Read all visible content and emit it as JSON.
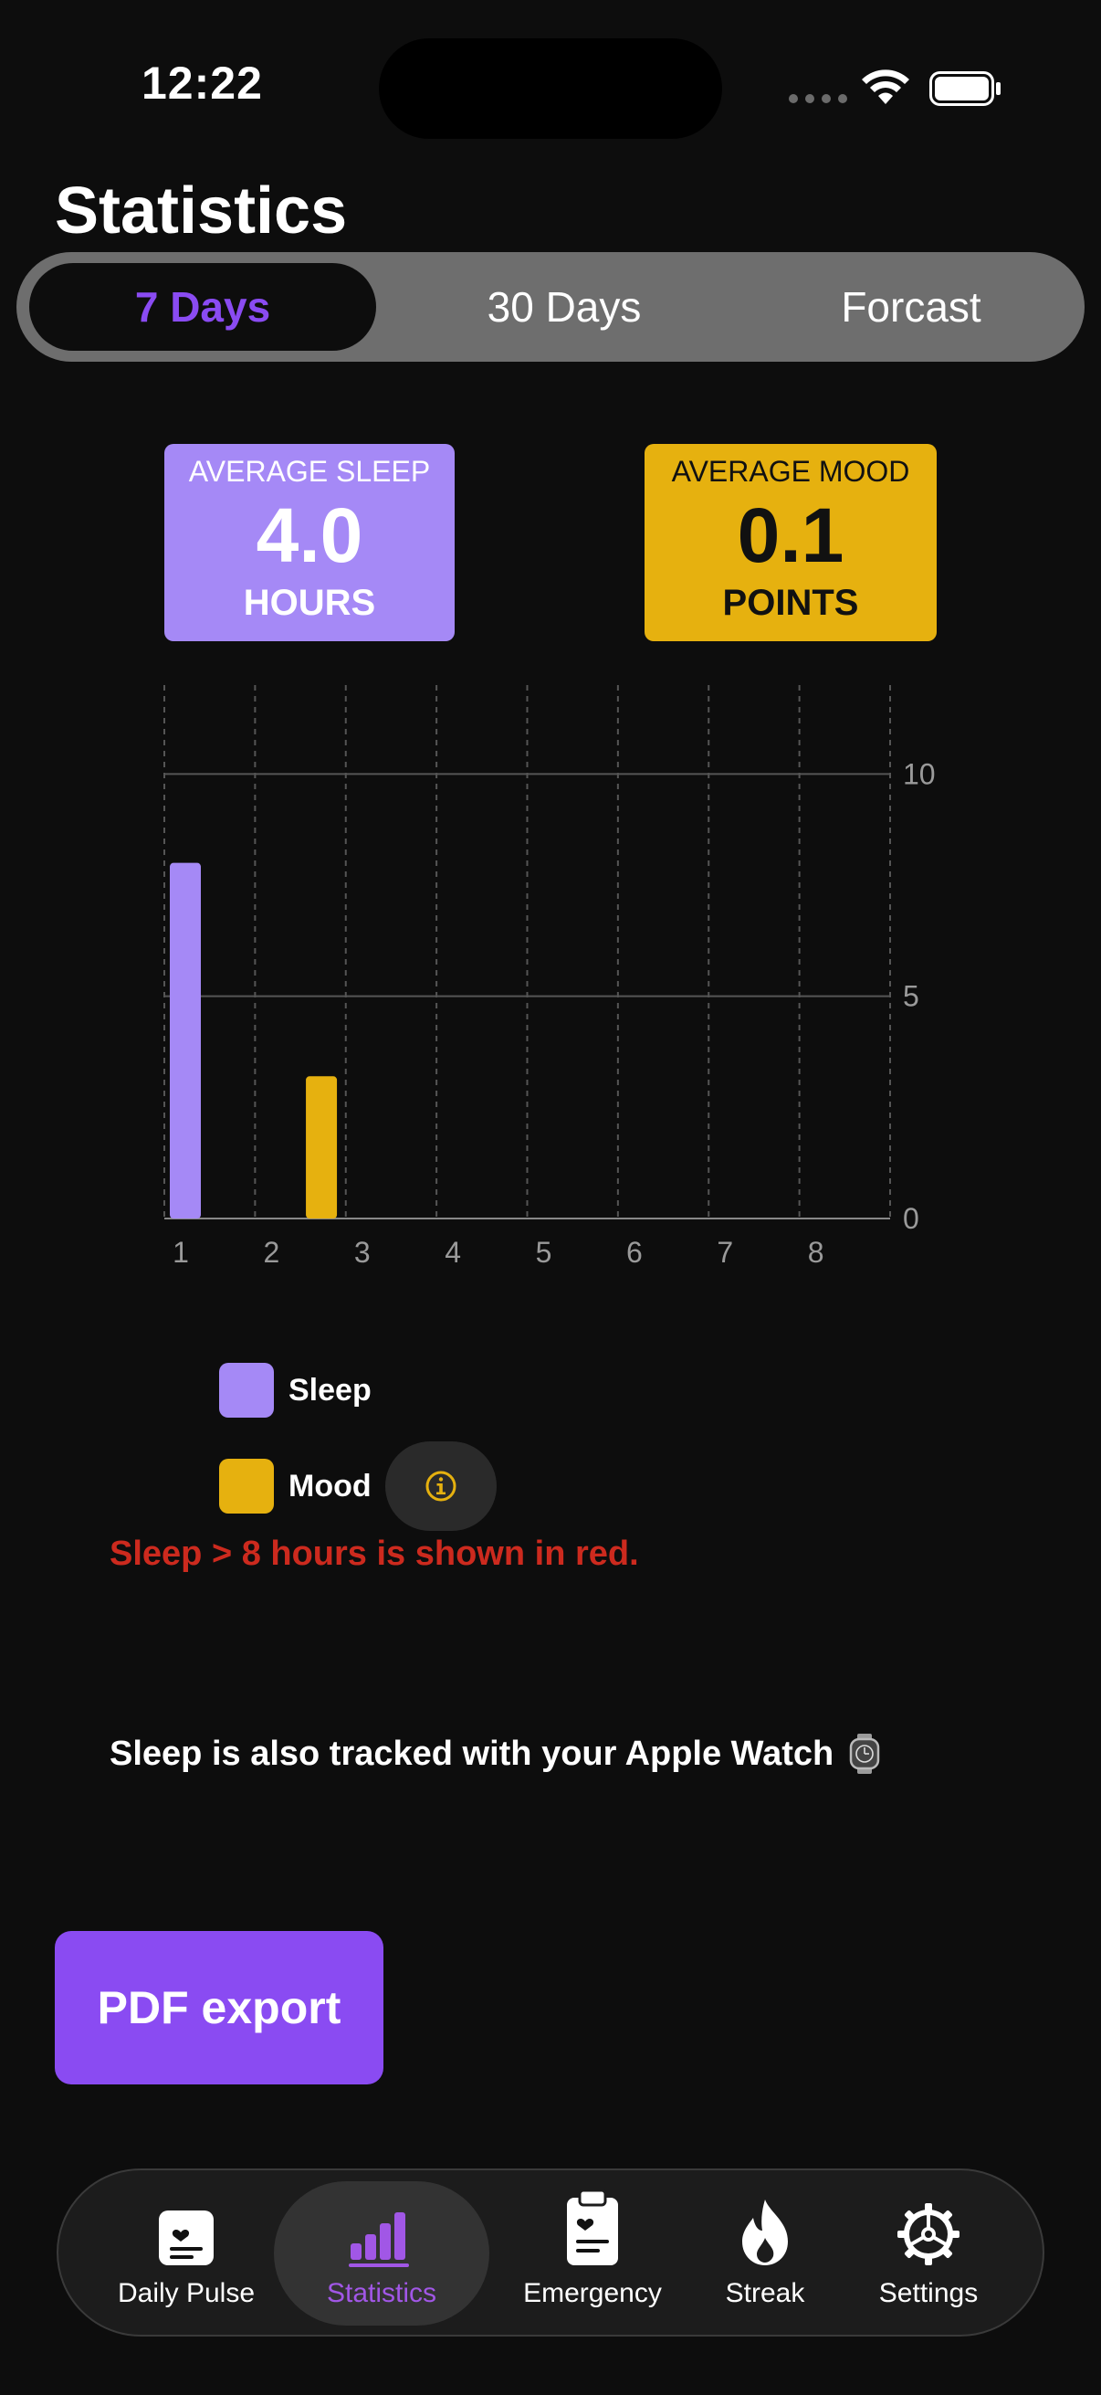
{
  "status_bar": {
    "time": "12:22",
    "icons": [
      "signal-dots-icon",
      "wifi-icon",
      "battery-icon"
    ]
  },
  "page": {
    "title": "Statistics"
  },
  "range_tabs": {
    "items": [
      {
        "label": "7 Days",
        "active": true
      },
      {
        "label": "30 Days",
        "active": false
      },
      {
        "label": "Forcast",
        "active": false
      }
    ]
  },
  "summary": {
    "sleep": {
      "caption": "AVERAGE SLEEP",
      "value": "4.0",
      "unit": "HOURS",
      "color": "#a589f6"
    },
    "mood": {
      "caption": "AVERAGE MOOD",
      "value": "0.1",
      "unit": "POINTS",
      "color": "#e6b10f"
    }
  },
  "chart_data": {
    "type": "bar",
    "x": [
      1,
      2,
      3,
      4,
      5,
      6,
      7,
      8
    ],
    "xlim": [
      1,
      9
    ],
    "ylim": [
      0,
      12
    ],
    "y_ticks": [
      0,
      5,
      10
    ],
    "x_ticks": [
      1,
      2,
      3,
      4,
      5,
      6,
      7,
      8
    ],
    "grid": true,
    "series": [
      {
        "name": "Sleep",
        "color": "#a589f6",
        "points": [
          {
            "x": 1,
            "y": 8
          }
        ]
      },
      {
        "name": "Mood",
        "color": "#e6b10f",
        "points": [
          {
            "x": 2.5,
            "y": 3.2
          }
        ]
      }
    ]
  },
  "legend": {
    "items": [
      {
        "label": "Sleep",
        "color": "#a589f6"
      },
      {
        "label": "Mood",
        "color": "#e6b10f"
      }
    ],
    "info_icon": "info-circle-icon"
  },
  "notes": {
    "red_note": "Sleep > 8 hours is shown in red.",
    "watch_note": "Sleep is also tracked with your Apple Watch",
    "watch_icon": "apple-watch-icon",
    "red_color": "#cc2a1e"
  },
  "actions": {
    "pdf_export": "PDF export",
    "accent": "#8a4bf2"
  },
  "tabbar": {
    "items": [
      {
        "label": "Daily Pulse",
        "icon": "heart-note-icon",
        "active": false
      },
      {
        "label": "Statistics",
        "icon": "bar-chart-icon",
        "active": true
      },
      {
        "label": "Emergency",
        "icon": "clipboard-heart-icon",
        "active": false
      },
      {
        "label": "Streak",
        "icon": "flame-icon",
        "active": false
      },
      {
        "label": "Settings",
        "icon": "gear-icon",
        "active": false
      }
    ],
    "active_color": "#a157e6"
  }
}
